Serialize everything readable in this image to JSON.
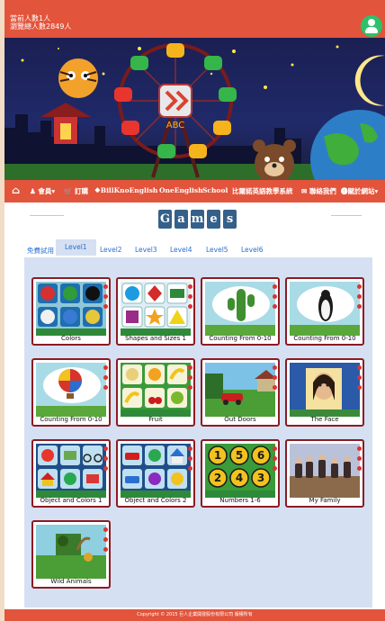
{
  "header": {
    "online_label": "當前人數1人",
    "total_label": "瀏覽總人數2849人"
  },
  "nav": {
    "items": [
      {
        "label": "會員",
        "caret": true
      },
      {
        "label": "訂購"
      },
      {
        "label": "BillKnoEnglish"
      },
      {
        "label": "OneEnglish"
      },
      {
        "label": "School"
      },
      {
        "label": "比爾諾英語教學系統"
      },
      {
        "label": "聯絡我們"
      },
      {
        "label": "關於網站",
        "caret": true
      }
    ]
  },
  "games_title_letters": [
    "G",
    "a",
    "m",
    "e",
    "s"
  ],
  "tabs": [
    {
      "label": "免費試用",
      "active": false
    },
    {
      "label": "Level1",
      "active": true
    },
    {
      "label": "Level2",
      "active": false
    },
    {
      "label": "Level3",
      "active": false
    },
    {
      "label": "Level4",
      "active": false
    },
    {
      "label": "Level5",
      "active": false
    },
    {
      "label": "Level6",
      "active": false
    }
  ],
  "games": [
    {
      "title": "Colors"
    },
    {
      "title": "Shapes and Sizes 1"
    },
    {
      "title": "Counting From 0-10"
    },
    {
      "title": "Counting From 0-10"
    },
    {
      "title": "Counting From 0-10"
    },
    {
      "title": "Fruit"
    },
    {
      "title": "Out Doors"
    },
    {
      "title": "The Face"
    },
    {
      "title": "Object and Colors 1"
    },
    {
      "title": "Object and Colors 2"
    },
    {
      "title": "Numbers 1-6"
    },
    {
      "title": "My Family"
    },
    {
      "title": "Wild Animals"
    }
  ],
  "banner": {
    "logo_text": "ABC"
  },
  "footer": {
    "copyright": "Copyright © 2015 巨人企業開發股份有限公司 版權所有"
  },
  "colors": {
    "accent": "#e2543b",
    "card_border": "#8c1b22",
    "panel": "#d5e1f2",
    "title_tile": "#35608a"
  }
}
